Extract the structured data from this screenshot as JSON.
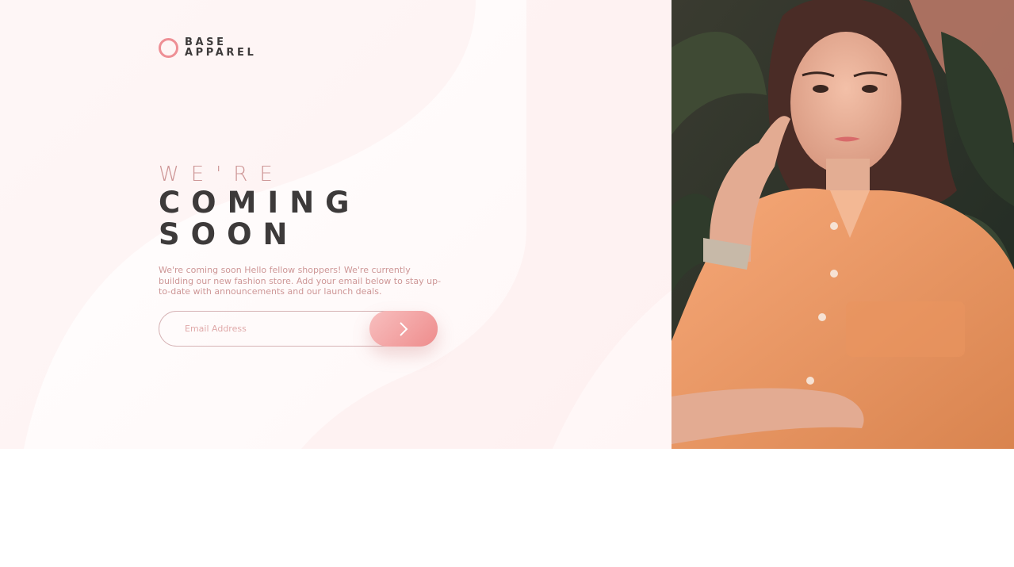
{
  "brand": {
    "line1": "BASE",
    "line2": "APPAREL",
    "accent_color": "#ee8f95",
    "dark_color": "#3d3a3a"
  },
  "headline": {
    "light": "WE'RE",
    "bold_line1": "COMING",
    "bold_line2": "SOON"
  },
  "description": "We're coming soon Hello fellow shoppers! We're currently building our new fashion store. Add your email below to stay up-to-date with announcements and our launch deals.",
  "form": {
    "email_placeholder": "Email Address",
    "email_value": "",
    "submit_icon": "chevron-right-icon"
  },
  "hero_image": {
    "subject": "woman-in-peach-shirt-photo"
  },
  "colors": {
    "soft_pink": "#ce9797",
    "button_gradient_start": "#f8bfbf",
    "button_gradient_end": "#ee8c8c"
  }
}
